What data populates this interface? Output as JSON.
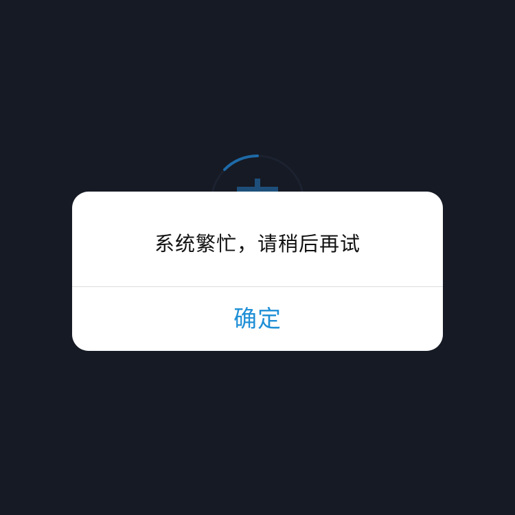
{
  "dialog": {
    "message": "系统繁忙，请稍后再试",
    "confirm_label": "确定"
  },
  "colors": {
    "background": "#161a24",
    "dialog_background": "#ffffff",
    "message_text": "#111111",
    "confirm_text": "#1f8fd6",
    "spinner_arc": "#1e6aa8",
    "divider": "#dcdcdc"
  },
  "icons": {
    "spinner": "loading-spinner-icon"
  }
}
